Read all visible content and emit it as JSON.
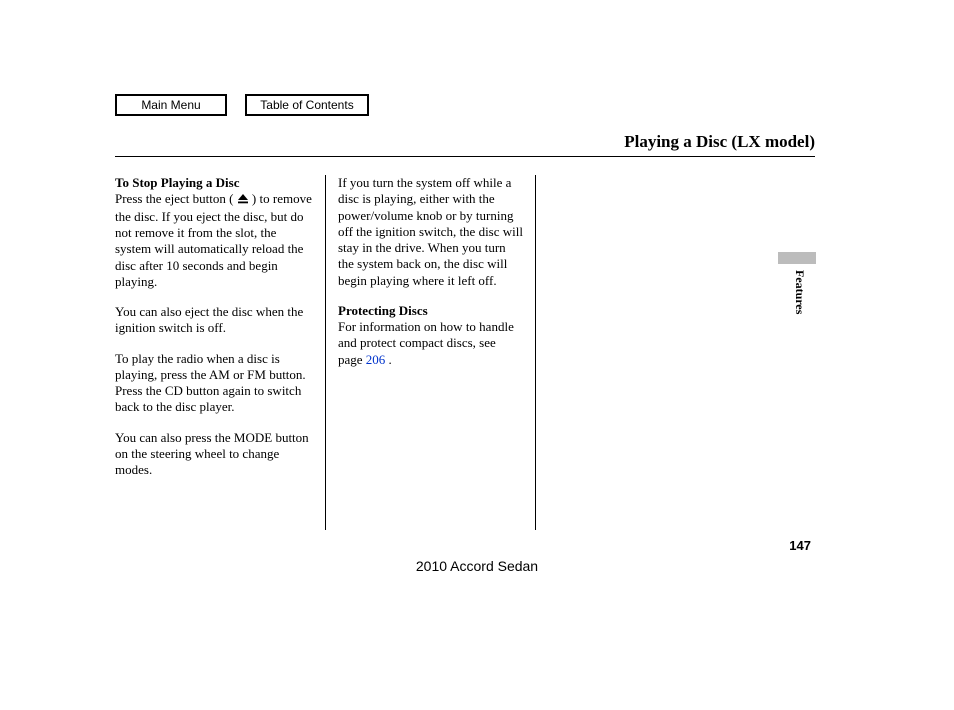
{
  "nav": {
    "main_menu": "Main Menu",
    "toc": "Table of Contents"
  },
  "title": "Playing a Disc (LX model)",
  "col1": {
    "h1": "To Stop Playing a Disc",
    "p1a": "Press the eject button (",
    "p1b": ") to remove the disc. If you eject the disc, but do not remove it from the slot, the system will automatically reload the disc after 10 seconds and begin playing.",
    "p2": "You can also eject the disc when the ignition switch is off.",
    "p3": "To play the radio when a disc is playing, press the AM or FM button. Press the CD button again to switch back to the disc player.",
    "p4": "You can also press the MODE button on the steering wheel to change modes."
  },
  "col2": {
    "p1": "If you turn the system off while a disc is playing, either with the power/volume knob or by turning off the ignition switch, the disc will stay in the drive. When you turn the system back on, the disc will begin playing where it left off.",
    "h2": "Protecting Discs",
    "p2a": "For information on how to handle and protect compact discs, see page ",
    "link": "206",
    "p2b": " ."
  },
  "sidebar": {
    "section": "Features"
  },
  "page_number": "147",
  "footer": "2010 Accord Sedan",
  "icons": {
    "eject": "eject-icon"
  }
}
